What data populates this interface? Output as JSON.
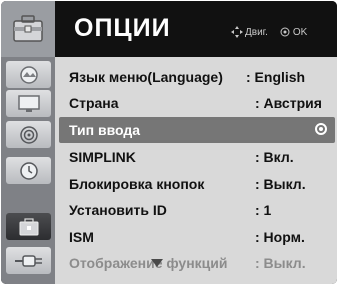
{
  "header": {
    "title": "ОПЦИИ",
    "hint_move": "Двиг.",
    "hint_ok": "OK"
  },
  "menu": {
    "items": [
      {
        "label": "Язык меню(Language)",
        "value": ": English"
      },
      {
        "label": "Страна",
        "value": ": Австрия"
      },
      {
        "label": "Тип ввода",
        "value": ""
      },
      {
        "label": "SIMPLINK",
        "value": ": Вкл."
      },
      {
        "label": "Блокировка кнопок",
        "value": ": Выкл."
      },
      {
        "label": "Установить ID",
        "value": ": 1"
      },
      {
        "label": "ISM",
        "value": ": Норм."
      },
      {
        "label": "Отображение функций",
        "value": ": Выкл."
      }
    ],
    "selected_index": 2
  },
  "sidebar": {
    "icons": [
      "options-toolbox-icon",
      "picture-icon",
      "monitor-icon",
      "audio-icon",
      "clock-icon",
      "options-icon",
      "input-plug-icon"
    ],
    "selected": "options-icon"
  },
  "colors": {
    "panel": "#d9d9d9",
    "highlight": "#767676",
    "rail": "#7f8186"
  }
}
